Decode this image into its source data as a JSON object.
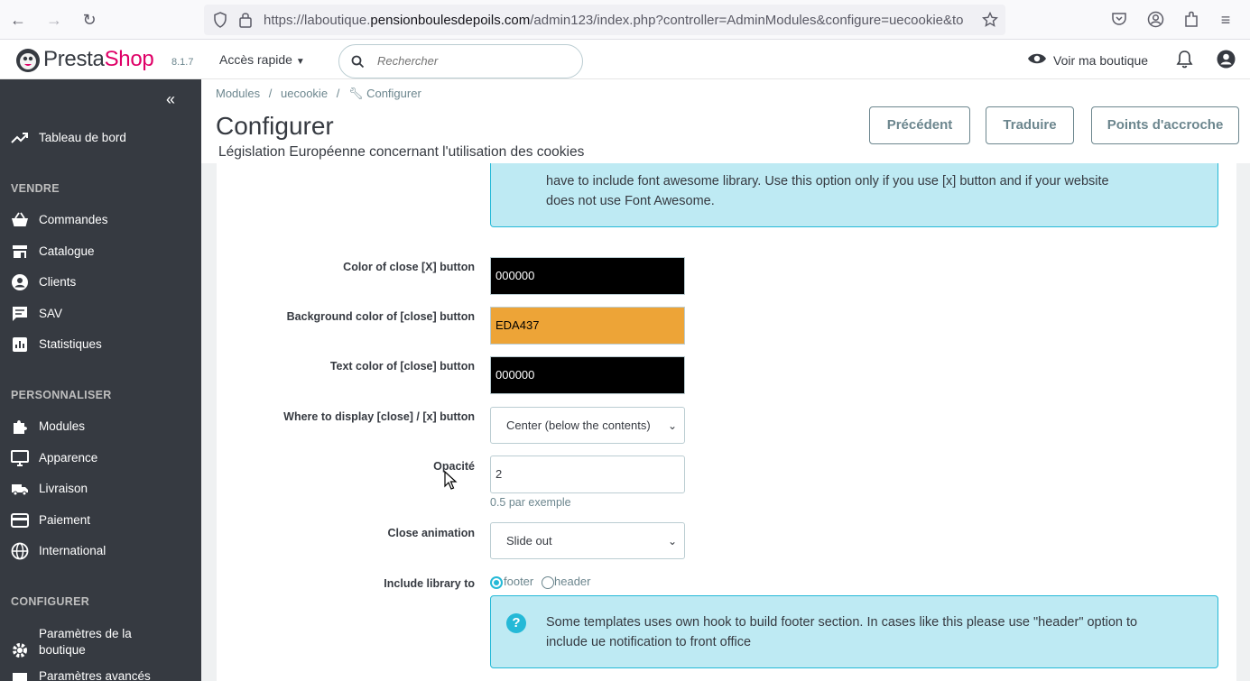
{
  "browser": {
    "url_prefix": "https://laboutique.",
    "url_domain": "pensionboulesdepoils.com",
    "url_path": "/admin123/index.php?controller=AdminModules&configure=uecookie&to"
  },
  "header": {
    "logo_presta": "Presta",
    "logo_shop": "Shop",
    "version": "8.1.7",
    "quick_access": "Accès rapide",
    "search_placeholder": "Rechercher",
    "view_shop": "Voir ma boutique"
  },
  "sidebar": {
    "dashboard": "Tableau de bord",
    "section_sell": "VENDRE",
    "sell_items": [
      "Commandes",
      "Catalogue",
      "Clients",
      "SAV",
      "Statistiques"
    ],
    "section_customize": "PERSONNALISER",
    "customize_items": [
      "Modules",
      "Apparence",
      "Livraison",
      "Paiement",
      "International"
    ],
    "section_configure": "CONFIGURER",
    "configure_items": [
      "Paramètres de la boutique",
      "Paramètres avancés"
    ]
  },
  "page": {
    "breadcrumb": [
      "Modules",
      "uecookie",
      "Configurer"
    ],
    "title": "Configurer",
    "subtitle": "Législation Européenne concernant l'utilisation des cookies",
    "buttons": [
      "Précédent",
      "Traduire",
      "Points d'accroche"
    ]
  },
  "form": {
    "top_alert_line1": "have to include font awesome library. Use this option only if you use [x] button and if your website",
    "top_alert_line2": "does not use Font Awesome.",
    "close_color_label": "Color of close [X] button",
    "close_color_value": "000000",
    "close_bg_label": "Background color of [close] button",
    "close_bg_value": "EDA437",
    "close_text_label": "Text color of [close] button",
    "close_text_value": "000000",
    "where_label": "Where to display [close] / [x] button",
    "where_value": "Center (below the contents)",
    "opacity_label": "Opacité",
    "opacity_value": "2",
    "opacity_help": "0.5 par exemple",
    "animation_label": "Close animation",
    "animation_value": "Slide out",
    "library_label": "Include library to",
    "library_options": [
      "footer",
      "header"
    ],
    "bottom_alert_line1": "Some templates uses own hook to build footer section. In cases like this please use \"header\" option to",
    "bottom_alert_line2": "include ue notification to front office"
  },
  "colors": {
    "black": "#000000",
    "orange": "#EDA437",
    "accent": "#25b9d7",
    "sidebar": "#363a41"
  }
}
